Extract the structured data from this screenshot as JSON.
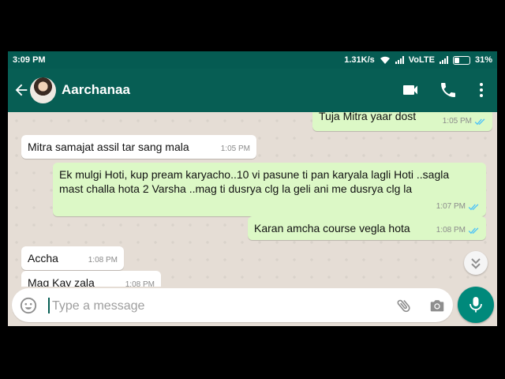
{
  "status_bar": {
    "time": "3:09 PM",
    "speed": "1.31K/s",
    "network": "VoLTE",
    "battery": "31%"
  },
  "header": {
    "contact_name": "Aarchanaa",
    "icons": [
      "back-arrow-icon",
      "video-call-icon",
      "phone-icon",
      "more-vert-icon"
    ]
  },
  "messages": [
    {
      "dir": "out",
      "text": "Tuja Mitra yaar dost",
      "time": "1:05 PM",
      "status": "read"
    },
    {
      "dir": "in",
      "text": "Mitra samajat assil tar sang mala",
      "time": "1:05 PM"
    },
    {
      "dir": "out",
      "text": "Ek mulgi Hoti, kup pream karyacho..10 vi pasune ti pan karyala lagli Hoti ..sagla mast challa hota 2 Varsha ..mag ti dusrya clg la geli ani me dusrya clg la",
      "time": "1:07 PM",
      "status": "read"
    },
    {
      "dir": "out",
      "text": "Karan amcha course vegla hota",
      "time": "1:08 PM",
      "status": "read"
    },
    {
      "dir": "in",
      "text": "Accha",
      "time": "1:08 PM"
    },
    {
      "dir": "in",
      "text": "Mag Kay zala",
      "time": "1:08 PM"
    }
  ],
  "composer": {
    "placeholder": "Type a message"
  },
  "colors": {
    "status_bar": "#055b52",
    "header": "#075e54",
    "outgoing_bubble": "#dcf8c6",
    "incoming_bubble": "#ffffff",
    "read_ticks": "#4fc3f7",
    "mic_button": "#00897b"
  }
}
